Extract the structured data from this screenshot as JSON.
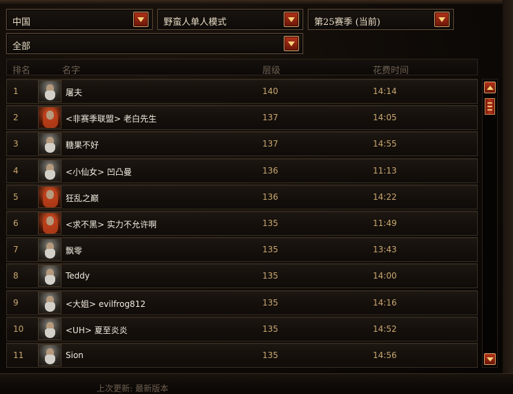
{
  "filters": {
    "region": "中国",
    "mode": "野蛮人单人模式",
    "season": "第25赛季 (当前)",
    "category": "全部"
  },
  "columns": {
    "rank": "排名",
    "name": "名字",
    "tier": "层级",
    "time": "花费时间"
  },
  "rows": [
    {
      "rank": "1",
      "name": "屠夫",
      "tier": "140",
      "time": "14:14",
      "portrait": "male-barbarian-portrait"
    },
    {
      "rank": "2",
      "name": "<非赛季联盟> 老白先生",
      "tier": "137",
      "time": "14:05",
      "portrait": "female-barbarian-portrait"
    },
    {
      "rank": "3",
      "name": "糖果不好",
      "tier": "137",
      "time": "14:55",
      "portrait": "male-barbarian-portrait"
    },
    {
      "rank": "4",
      "name": "<小仙女> 凹凸曼",
      "tier": "136",
      "time": "11:13",
      "portrait": "male-barbarian-portrait"
    },
    {
      "rank": "5",
      "name": "狂乱之巅",
      "tier": "136",
      "time": "14:22",
      "portrait": "female-barbarian-portrait"
    },
    {
      "rank": "6",
      "name": "<求不黑> 实力不允许啊",
      "tier": "135",
      "time": "11:49",
      "portrait": "female-barbarian-portrait"
    },
    {
      "rank": "7",
      "name": "飘零",
      "tier": "135",
      "time": "13:43",
      "portrait": "male-barbarian-portrait"
    },
    {
      "rank": "8",
      "name": "Teddy",
      "tier": "135",
      "time": "14:00",
      "portrait": "male-barbarian-portrait"
    },
    {
      "rank": "9",
      "name": "<大姐> evilfrog812",
      "tier": "135",
      "time": "14:16",
      "portrait": "male-barbarian-portrait"
    },
    {
      "rank": "10",
      "name": "<UH> 夏至炎炎",
      "tier": "135",
      "time": "14:52",
      "portrait": "male-barbarian-portrait"
    },
    {
      "rank": "11",
      "name": "Sion",
      "tier": "135",
      "time": "14:56",
      "portrait": "male-barbarian-portrait"
    }
  ],
  "footer": {
    "last_update": "上次更新: 最新版本"
  },
  "colors": {
    "accent": "#b4321a",
    "value_text": "#c9a871",
    "name_text": "#f1ebe0"
  }
}
